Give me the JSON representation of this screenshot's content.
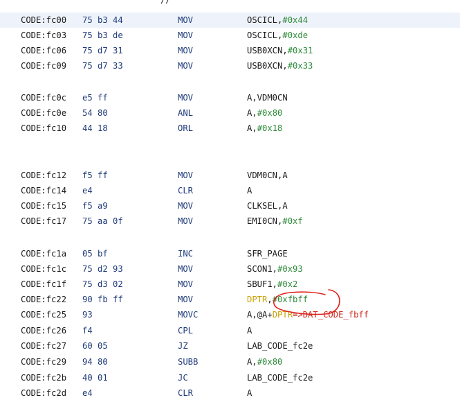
{
  "header_fragment": "//",
  "colors": {
    "selection": "#eef3fb",
    "hex": "#2e8b3a",
    "register": "#c8a100",
    "xref": "#cc2a1c",
    "mnemonic": "#1e3a7a",
    "annotation": "#e0201a"
  },
  "rows": [
    {
      "address": "CODE:fc00",
      "bytes": "75 b3 44",
      "mnemonic": "MOV",
      "operands": [
        {
          "text": "OSCICL,",
          "type": "sym"
        },
        {
          "text": "#0x44",
          "type": "hex"
        }
      ]
    },
    {
      "address": "CODE:fc03",
      "bytes": "75 b3 de",
      "mnemonic": "MOV",
      "operands": [
        {
          "text": "OSCICL,",
          "type": "sym"
        },
        {
          "text": "#0xde",
          "type": "hex"
        }
      ]
    },
    {
      "address": "CODE:fc06",
      "bytes": "75 d7 31",
      "mnemonic": "MOV",
      "operands": [
        {
          "text": "USB0XCN,",
          "type": "sym"
        },
        {
          "text": "#0x31",
          "type": "hex"
        }
      ]
    },
    {
      "address": "CODE:fc09",
      "bytes": "75 d7 33",
      "mnemonic": "MOV",
      "operands": [
        {
          "text": "USB0XCN,",
          "type": "sym"
        },
        {
          "text": "#0x33",
          "type": "hex"
        }
      ]
    },
    {
      "address": "CODE:fc0c",
      "bytes": "e5 ff",
      "mnemonic": "MOV",
      "operands": [
        {
          "text": "A,VDM0CN",
          "type": "sym"
        }
      ]
    },
    {
      "address": "CODE:fc0e",
      "bytes": "54 80",
      "mnemonic": "ANL",
      "operands": [
        {
          "text": "A,",
          "type": "sym"
        },
        {
          "text": "#0x80",
          "type": "hex"
        }
      ]
    },
    {
      "address": "CODE:fc10",
      "bytes": "44 18",
      "mnemonic": "ORL",
      "operands": [
        {
          "text": "A,",
          "type": "sym"
        },
        {
          "text": "#0x18",
          "type": "hex"
        }
      ]
    },
    {
      "address": "CODE:fc12",
      "bytes": "f5 ff",
      "mnemonic": "MOV",
      "operands": [
        {
          "text": "VDM0CN,A",
          "type": "sym"
        }
      ]
    },
    {
      "address": "CODE:fc14",
      "bytes": "e4",
      "mnemonic": "CLR",
      "operands": [
        {
          "text": "A",
          "type": "sym"
        }
      ]
    },
    {
      "address": "CODE:fc15",
      "bytes": "f5 a9",
      "mnemonic": "MOV",
      "operands": [
        {
          "text": "CLKSEL,A",
          "type": "sym"
        }
      ]
    },
    {
      "address": "CODE:fc17",
      "bytes": "75 aa 0f",
      "mnemonic": "MOV",
      "operands": [
        {
          "text": "EMI0CN,",
          "type": "sym"
        },
        {
          "text": "#0xf",
          "type": "hex"
        }
      ]
    },
    {
      "address": "CODE:fc1a",
      "bytes": "05 bf",
      "mnemonic": "INC",
      "operands": [
        {
          "text": "SFR_PAGE",
          "type": "sym"
        }
      ]
    },
    {
      "address": "CODE:fc1c",
      "bytes": "75 d2 93",
      "mnemonic": "MOV",
      "operands": [
        {
          "text": "SCON1,",
          "type": "sym"
        },
        {
          "text": "#0x93",
          "type": "hex"
        }
      ]
    },
    {
      "address": "CODE:fc1f",
      "bytes": "75 d3 02",
      "mnemonic": "MOV",
      "operands": [
        {
          "text": "SBUF1,",
          "type": "sym"
        },
        {
          "text": "#0x2",
          "type": "hex"
        }
      ]
    },
    {
      "address": "CODE:fc22",
      "bytes": "90 fb ff",
      "mnemonic": "MOV",
      "operands": [
        {
          "text": "DPTR",
          "type": "reg"
        },
        {
          "text": ",",
          "type": "plain"
        },
        {
          "text": "#0xfbff",
          "type": "hex"
        }
      ]
    },
    {
      "address": "CODE:fc25",
      "bytes": "93",
      "mnemonic": "MOVC",
      "operands": [
        {
          "text": "A,@A+",
          "type": "sym"
        },
        {
          "text": "DPTR",
          "type": "reg"
        },
        {
          "text": "=>DAT_CODE_fbff",
          "type": "xref"
        }
      ]
    },
    {
      "address": "CODE:fc26",
      "bytes": "f4",
      "mnemonic": "CPL",
      "operands": [
        {
          "text": "A",
          "type": "sym"
        }
      ]
    },
    {
      "address": "CODE:fc27",
      "bytes": "60 05",
      "mnemonic": "JZ",
      "operands": [
        {
          "text": "LAB_CODE_fc2e",
          "type": "lbl"
        }
      ]
    },
    {
      "address": "CODE:fc29",
      "bytes": "94 80",
      "mnemonic": "SUBB",
      "operands": [
        {
          "text": "A,",
          "type": "sym"
        },
        {
          "text": "#0x80",
          "type": "hex"
        }
      ]
    },
    {
      "address": "CODE:fc2b",
      "bytes": "40 01",
      "mnemonic": "JC",
      "operands": [
        {
          "text": "LAB_CODE_fc2e",
          "type": "lbl"
        }
      ]
    },
    {
      "address": "CODE:fc2d",
      "bytes": "e4",
      "mnemonic": "CLR",
      "operands": [
        {
          "text": "A",
          "type": "sym"
        }
      ]
    }
  ]
}
